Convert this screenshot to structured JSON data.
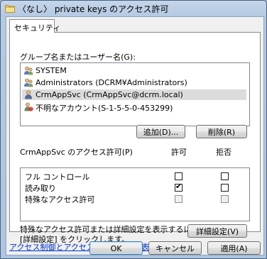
{
  "window": {
    "title": "〈なし〉 private keys のアクセス許可"
  },
  "tabs": [
    {
      "label": "セキュリティ"
    }
  ],
  "groups_label": "グループ名またはユーザー名(G):",
  "principals": [
    {
      "name": "SYSTEM",
      "icon": "group-icon"
    },
    {
      "name": "Administrators (DCRM¥Administrators)",
      "icon": "group-icon"
    },
    {
      "name": "CrmAppSvc (CrmAppSvc@dcrm.local)",
      "icon": "user-icon",
      "selected": true
    },
    {
      "name": "不明なアカウント(S-1-5-5-0-453299)",
      "icon": "unknown-account-icon"
    }
  ],
  "buttons": {
    "add": "追加(D)...",
    "remove": "削除(R)",
    "advanced": "詳細設定(V)",
    "ok": "OK",
    "cancel": "キャンセル",
    "apply": "適用(A)"
  },
  "permissions": {
    "header": "CrmAppSvc のアクセス許可(P)",
    "allow_header": "許可",
    "deny_header": "拒否",
    "rows": [
      {
        "name": "フル コントロール",
        "allow": false,
        "deny": false,
        "allow_disabled": false,
        "deny_disabled": false
      },
      {
        "name": "読み取り",
        "allow": true,
        "deny": false,
        "allow_disabled": false,
        "deny_disabled": false
      },
      {
        "name": "特殊なアクセス許可",
        "allow": false,
        "deny": false,
        "allow_disabled": true,
        "deny_disabled": true
      }
    ]
  },
  "special_note": {
    "line1": "特殊なアクセス許可または詳細設定を表示するには、",
    "line2": "[詳細設定] をクリックします。"
  },
  "help_link": "アクセス制御とアクセス許可の詳細を表示します。",
  "colors": {
    "title_bar": "#b4c9e2",
    "link": "#0033cc",
    "selection": "#dcdcdc"
  }
}
